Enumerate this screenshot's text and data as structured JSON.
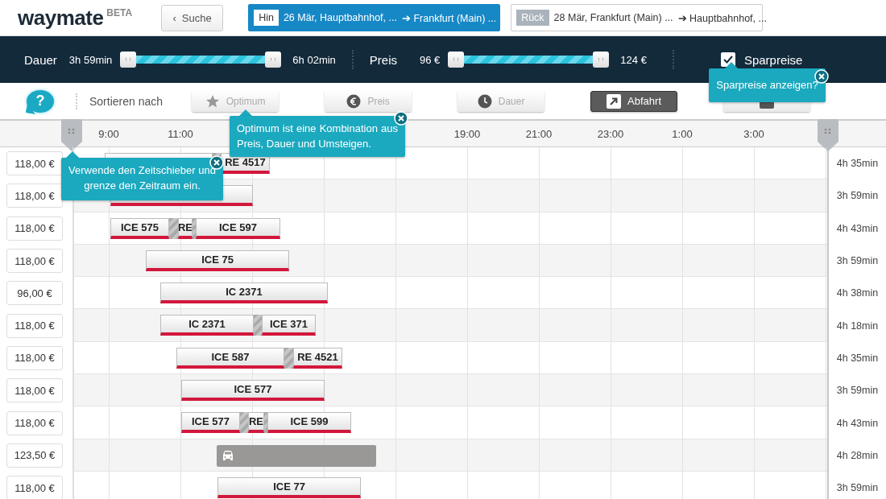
{
  "header": {
    "logo": "waymate",
    "badge": "BETA",
    "back": {
      "icon": "‹",
      "label": "Suche"
    },
    "trips": [
      {
        "tag": "Hin",
        "from": "26 Mär, Hauptbahnhof, ...",
        "arrow": "➔",
        "to": "Frankfurt (Main) ...",
        "selected": true
      },
      {
        "tag": "Rück",
        "from": "28 Mär, Frankfurt (Main) ...",
        "arrow": "➔",
        "to": "Hauptbahnhof, ...",
        "selected": false
      }
    ]
  },
  "filters": {
    "duration": {
      "label": "Dauer",
      "min": "3h 59min",
      "max": "6h 02min",
      "level": 1
    },
    "price": {
      "label": "Preis",
      "min": "96 €",
      "max": "124 €",
      "level": 1
    },
    "savings": {
      "label": "Sparpreise",
      "checked": true
    }
  },
  "sort": {
    "help": "?",
    "label": "Sortieren nach",
    "buttons": [
      {
        "kind": "star",
        "label": "Optimum",
        "selected": false
      },
      {
        "kind": "euro",
        "label": "Preis",
        "selected": false
      },
      {
        "kind": "clock",
        "label": "Dauer",
        "selected": false
      },
      {
        "kind": "departure",
        "label": "Abfahrt",
        "selected": true
      },
      {
        "kind": "arrival",
        "selected": false
      }
    ]
  },
  "timeline": {
    "axis_left": [
      "9:00",
      "11:00"
    ],
    "axis_right": [
      "19:00",
      "21:00",
      "23:00",
      "1:00",
      "3:00"
    ],
    "rows": [
      {
        "price": "118,00 €",
        "duration": "4h 35min",
        "segments": [
          {
            "kind": "train"
          },
          {
            "kind": "train",
            "label": "RE 4517"
          }
        ]
      },
      {
        "price": "118,00 €",
        "duration": "3h 59min",
        "segments": [
          {
            "kind": "train"
          }
        ]
      },
      {
        "price": "118,00 €",
        "duration": "4h 43min",
        "segments": [
          {
            "kind": "train",
            "label": "ICE 575"
          },
          {
            "kind": "train",
            "label": "RE"
          },
          {
            "kind": "train",
            "label": "ICE 597"
          }
        ]
      },
      {
        "price": "118,00 €",
        "duration": "3h 59min",
        "segments": [
          {
            "kind": "train",
            "label": "ICE 75"
          }
        ]
      },
      {
        "price": "96,00 €",
        "duration": "4h 38min",
        "segments": [
          {
            "kind": "train",
            "label": "IC 2371"
          }
        ]
      },
      {
        "price": "118,00 €",
        "duration": "4h 18min",
        "segments": [
          {
            "kind": "train",
            "label": "IC 2371"
          },
          {
            "kind": "train",
            "label": "ICE 371"
          }
        ]
      },
      {
        "price": "118,00 €",
        "duration": "4h 35min",
        "segments": [
          {
            "kind": "train",
            "label": "ICE 587"
          },
          {
            "kind": "train",
            "label": "RE 4521"
          }
        ]
      },
      {
        "price": "118,00 €",
        "duration": "3h 59min",
        "segments": [
          {
            "kind": "train",
            "label": "ICE 577"
          }
        ]
      },
      {
        "price": "118,00 €",
        "duration": "4h 43min",
        "segments": [
          {
            "kind": "train",
            "label": "ICE 577"
          },
          {
            "kind": "train",
            "label": "RE"
          },
          {
            "kind": "train",
            "label": "ICE 599"
          }
        ]
      },
      {
        "price": "123,50 €",
        "duration": "4h 28min",
        "segments": [
          {
            "kind": "car"
          }
        ]
      },
      {
        "price": "118,00 €",
        "duration": "3h 59min",
        "segments": [
          {
            "kind": "train",
            "label": "ICE 77"
          }
        ]
      }
    ]
  },
  "tooltips": [
    "Sparpreise anzeigen?",
    "Optimum ist eine Kombination aus Preis, Dauer und Umsteigen.",
    "Verwende den Zeitschieber und grenze den Zeitraum ein."
  ]
}
